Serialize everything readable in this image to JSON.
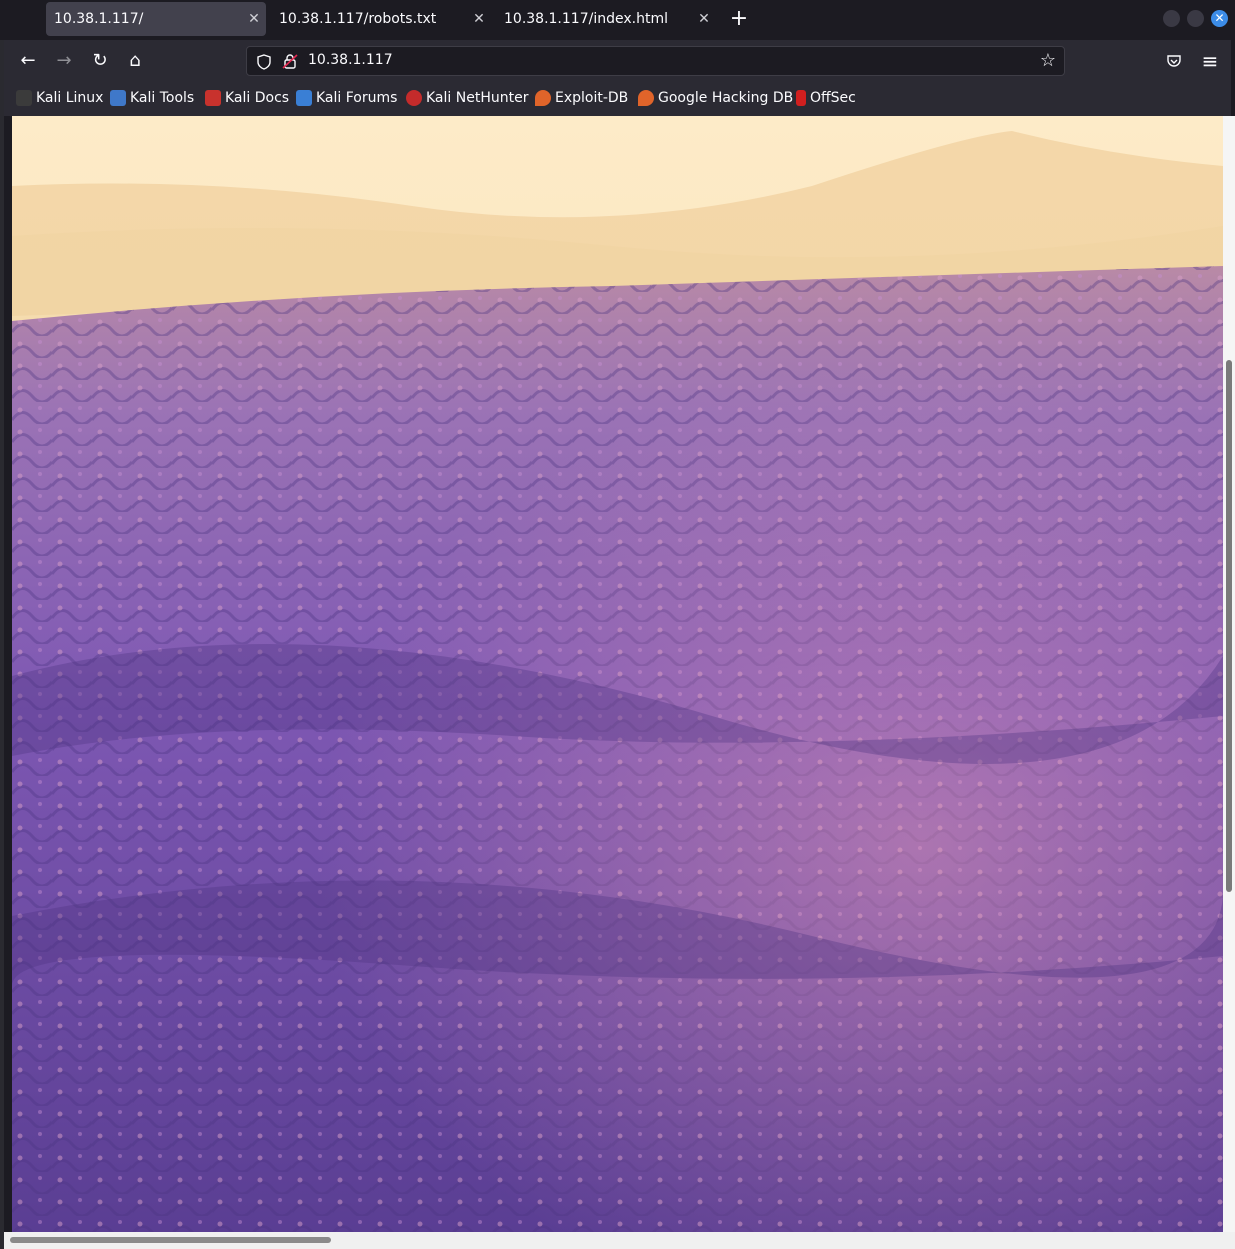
{
  "tabs": [
    {
      "label": "10.38.1.117/",
      "active": true
    },
    {
      "label": "10.38.1.117/robots.txt",
      "active": false
    },
    {
      "label": "10.38.1.117/index.html",
      "active": false
    }
  ],
  "new_tab_label": "+",
  "window_controls": {
    "close_glyph": "✕"
  },
  "nav": {
    "back_icon": "←",
    "forward_icon": "→",
    "reload_icon": "↻",
    "home_icon": "⌂",
    "url": "10.38.1.117",
    "bookmark_icon": "☆",
    "pocket_icon": "pocket-icon",
    "menu_icon": "≡"
  },
  "bookmarks": [
    {
      "label": "Kali Linux",
      "color": "#3b3b3b"
    },
    {
      "label": "Kali Tools",
      "color": "#3f78c9"
    },
    {
      "label": "Kali Docs",
      "color": "#c8322d"
    },
    {
      "label": "Kali Forums",
      "color": "#3a7fd5"
    },
    {
      "label": "Kali NetHunter",
      "color": "#c42b2b"
    },
    {
      "label": "Exploit-DB",
      "color": "#e0642a"
    },
    {
      "label": "Google Hacking DB",
      "color": "#e0642a"
    },
    {
      "label": "OffSec",
      "color": "#d11f1f"
    }
  ],
  "page": {
    "image_subject": "lavender field at sunset"
  },
  "colors": {
    "tab_active": "#42414d",
    "toolbar": "#2b2a33",
    "tabbar": "#1c1b22",
    "lavender": "#7b55b0",
    "sky": "#fbe3b8"
  }
}
